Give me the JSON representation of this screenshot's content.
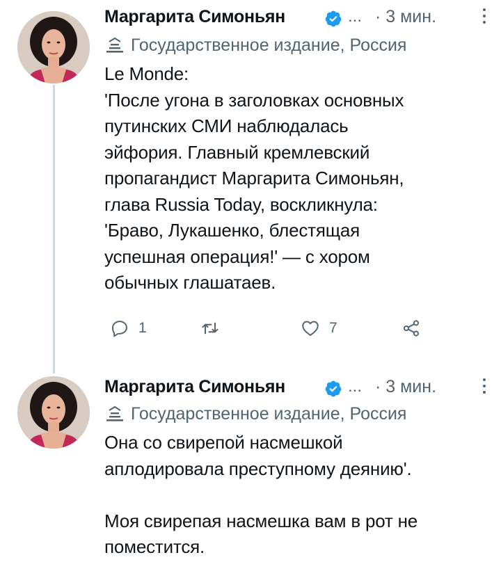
{
  "tweets": [
    {
      "author": "Маргарита Симоньян",
      "handle_truncated": "...",
      "time": "· 3 мин.",
      "label": "Государственное издание, Россия",
      "lines": [
        "Le Monde:",
        "'После угона в заголовках основных",
        "путинских СМИ наблюдалась",
        "эйфория. Главный кремлевский",
        "пропагандист Маргарита Симоньян,",
        "глава Russia Today, воскликнула:",
        "'Браво, Лукашенко, блестящая",
        "успешная операция!' — с хором",
        "обычных глашатаев."
      ],
      "actions": {
        "replies": "1",
        "likes": "7"
      }
    },
    {
      "author": "Маргарита Симоньян",
      "handle_truncated": "...",
      "time": "· 3 мин.",
      "label": "Государственное издание, Россия",
      "lines": [
        "Она со свирепой насмешкой",
        "аплодировала преступному деянию'.",
        "",
        "Моя свирепая насмешка вам в рот не",
        "поместится."
      ]
    }
  ],
  "icons": {
    "verified": "verified-badge-icon",
    "state_media": "state-media-icon",
    "reply": "reply-icon",
    "retweet": "retweet-icon",
    "like": "like-icon",
    "share": "share-icon",
    "more": "more-icon"
  },
  "colors": {
    "verified_blue": "#1d9bf0",
    "secondary_text": "#536471",
    "primary_text": "#0f1419"
  }
}
